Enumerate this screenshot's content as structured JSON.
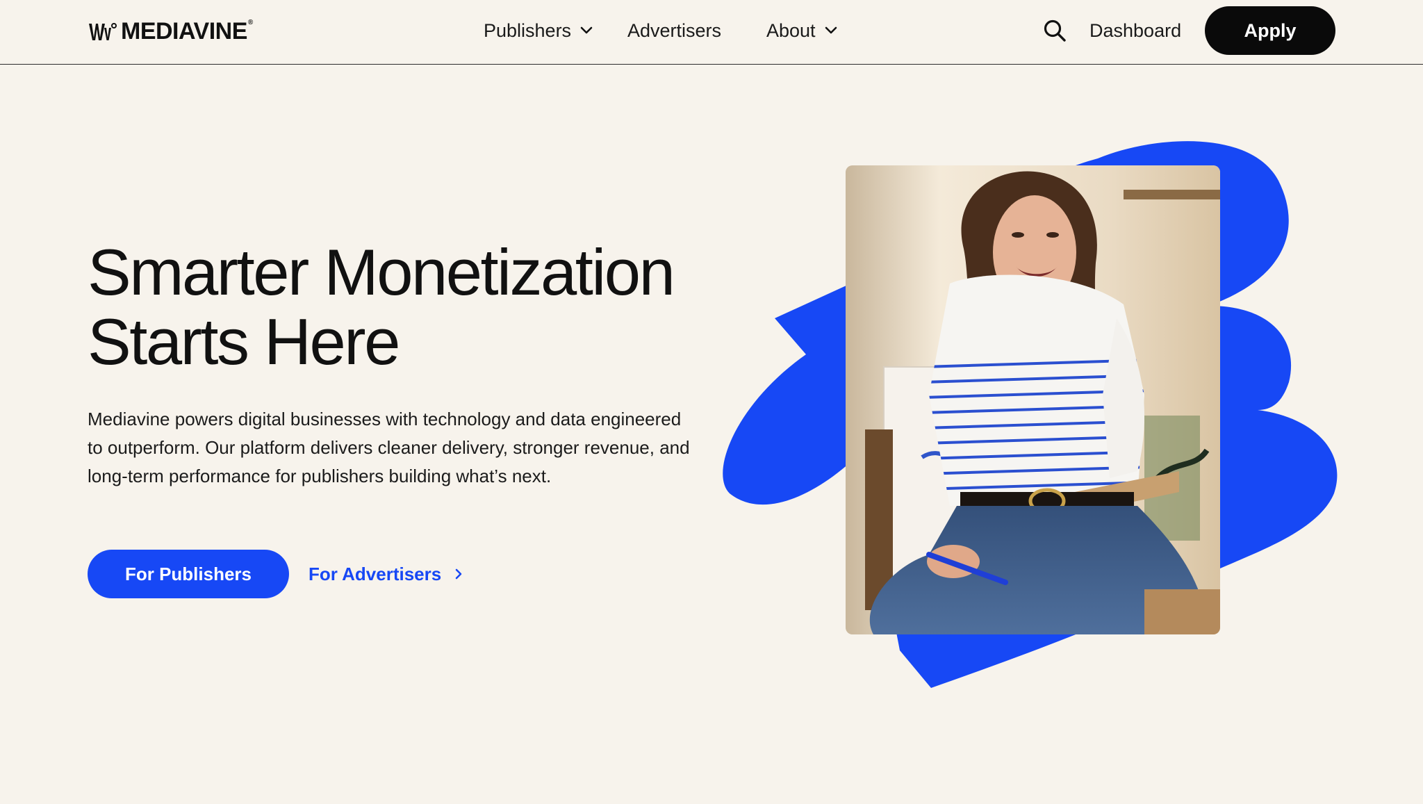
{
  "header": {
    "logo_text": "MEDIAVINE",
    "logo_reg": "®",
    "nav": [
      {
        "label": "Publishers",
        "has_dropdown": true
      },
      {
        "label": "Advertisers",
        "has_dropdown": false
      },
      {
        "label": "About",
        "has_dropdown": true
      }
    ],
    "search_icon": "search-icon",
    "dashboard_label": "Dashboard",
    "apply_label": "Apply"
  },
  "hero": {
    "title_line1": "Smarter Monetization",
    "title_line2": "Starts Here",
    "body": "Mediavine powers digital businesses with technology and data engineered to outperform. Our platform delivers cleaner delivery, stronger revenue, and long-term performance for publishers building what’s next.",
    "primary_cta": "For Publishers",
    "secondary_cta": "For Advertisers"
  },
  "colors": {
    "background": "#f7f3ec",
    "accent_blue": "#1748f5",
    "apply_button": "#0a0a0a",
    "text": "#111111"
  }
}
